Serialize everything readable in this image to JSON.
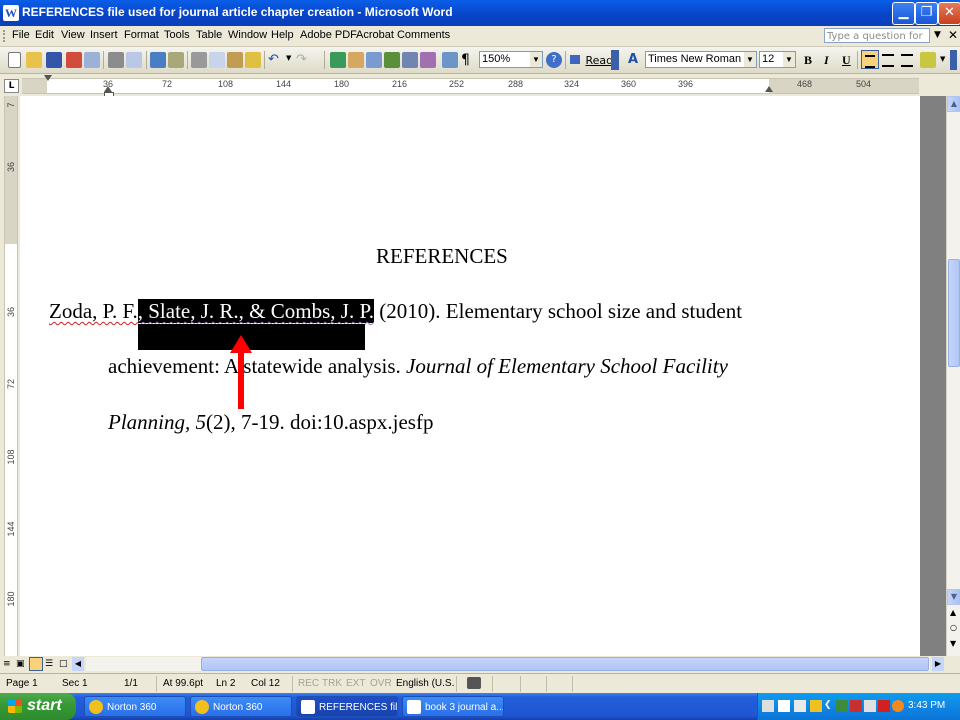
{
  "window": {
    "title": "REFERENCES file used for journal article chapter creation - Microsoft Word",
    "app_icon_letter": "W"
  },
  "menu": {
    "items": [
      "File",
      "Edit",
      "View",
      "Insert",
      "Format",
      "Tools",
      "Table",
      "Window",
      "Help",
      "Adobe PDF",
      "Acrobat Comments"
    ],
    "help_placeholder": "Type a question for help"
  },
  "toolbar": {
    "zoom": "150%",
    "read_label": "Read",
    "font_name": "Times New Roman",
    "font_size": "12",
    "bold": "B",
    "italic": "I",
    "underline": "U"
  },
  "ruler": {
    "labels": [
      "36",
      "72",
      "108",
      "144",
      "180",
      "216",
      "252",
      "288",
      "324",
      "360",
      "396",
      "468",
      "504"
    ],
    "vertical_labels": [
      "7",
      "36",
      "36",
      "72",
      "108",
      "144",
      "180"
    ]
  },
  "document": {
    "heading": "REFERENCES",
    "line1_author": "Zoda, P. F.",
    "line1_selected": ", Slate, J. R., & Combs, J. P.",
    "line1_rest": " (2010). Elementary school size and student",
    "line2_plain": "achievement: A statewide analysis. ",
    "line2_italic": "Journal of Elementary School Facility",
    "line3_italic": "Planning, 5",
    "line3_plain": "(2), 7-19. doi:10.aspx.jesfp"
  },
  "annotation": {
    "arrow_color": "#ff0000",
    "selection_color": "#000000"
  },
  "status": {
    "page": "Page 1",
    "sec": "Sec 1",
    "pages": "1/1",
    "at": "At 99.6pt",
    "ln": "Ln 2",
    "col": "Col 12",
    "rec": "REC",
    "trk": "TRK",
    "ext": "EXT",
    "ovr": "OVR",
    "language": "English (U.S."
  },
  "taskbar": {
    "start": "start",
    "tasks": [
      "Norton 360",
      "Norton 360",
      "REFERENCES fil...",
      "book 3 journal a..."
    ],
    "clock": "3:43 PM"
  },
  "colors": {
    "titlebar": "#0842c6",
    "taskbar": "#245edb",
    "start": "#379a37",
    "tray": "#1086e3"
  }
}
